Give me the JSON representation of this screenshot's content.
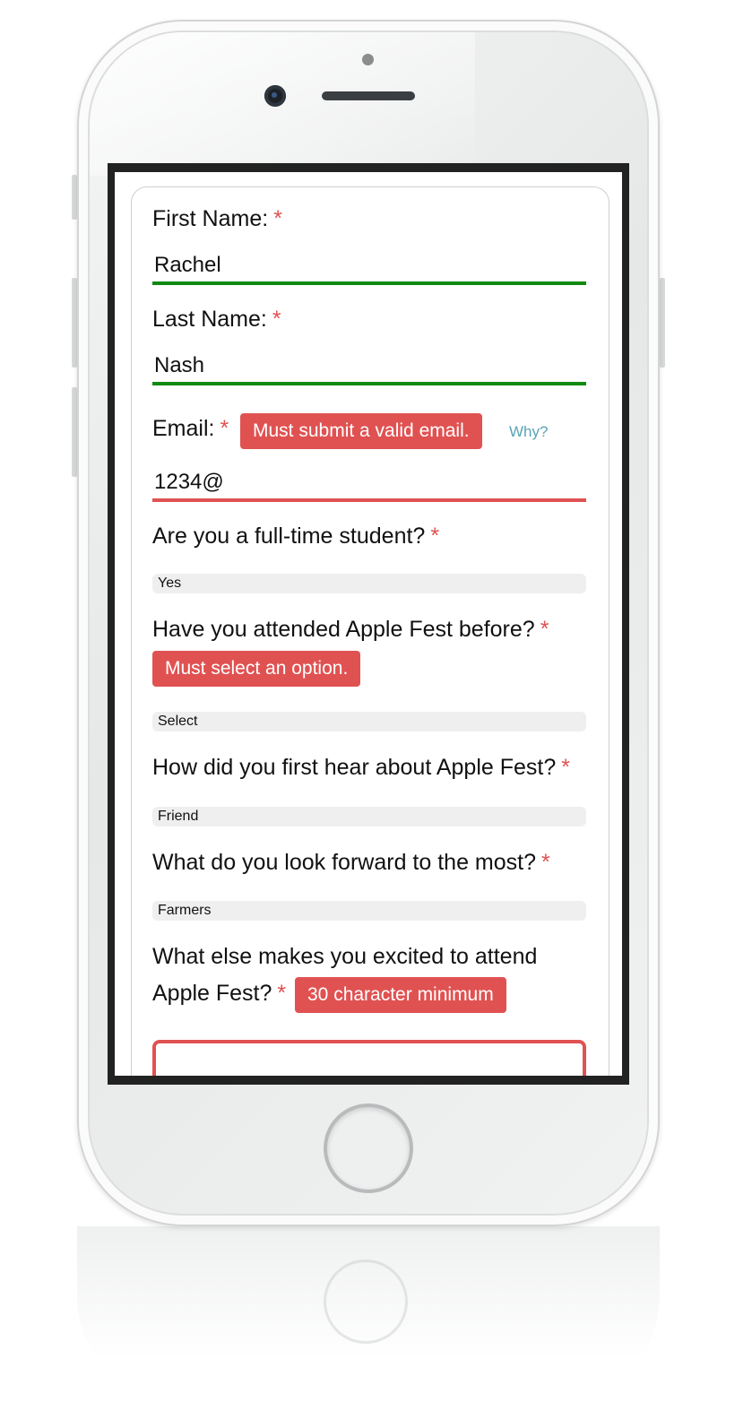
{
  "form": {
    "required_marker": "*",
    "first_name": {
      "label": "First Name:",
      "value": "Rachel"
    },
    "last_name": {
      "label": "Last Name:",
      "value": "Nash"
    },
    "email": {
      "label": "Email:",
      "value": "1234@",
      "error": "Must submit a valid email.",
      "help_link": "Why?"
    },
    "student": {
      "label": "Are you a full-time student?",
      "selected": "Yes"
    },
    "attended": {
      "label": "Have you attended Apple Fest before?",
      "error": "Must select an option.",
      "selected": "Select"
    },
    "heard": {
      "label": "How did you first hear about Apple Fest?",
      "selected": "Friend"
    },
    "forward": {
      "label": "What do you look forward to the most?",
      "selected": "Farmers"
    },
    "excited": {
      "label_line1": "What else makes you excited to attend",
      "label_line2": "Apple Fest?",
      "error": "30 character minimum",
      "value": ""
    }
  },
  "colors": {
    "error": "#e05252",
    "valid": "#118a11",
    "link": "#5aa3b5",
    "select_bg": "#efefef"
  }
}
